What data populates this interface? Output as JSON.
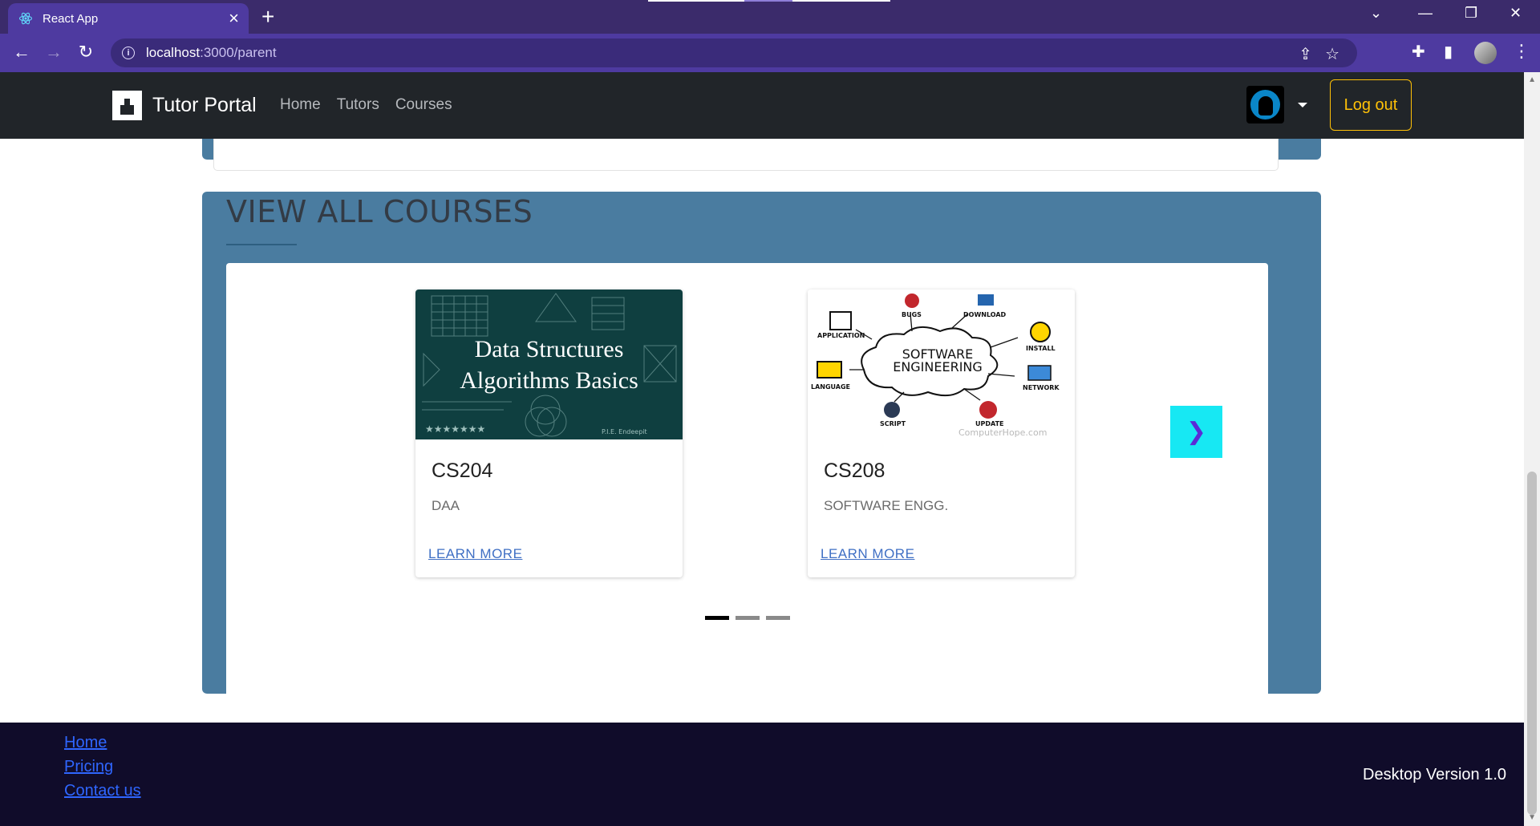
{
  "browser": {
    "tab_title": "React App",
    "url_host": "localhost",
    "url_path": ":3000/parent"
  },
  "navbar": {
    "brand": "Tutor Portal",
    "links": [
      "Home",
      "Tutors",
      "Courses"
    ],
    "logout_label": "Log out"
  },
  "courses": {
    "title": "VIEW ALL COURSES",
    "cards": [
      {
        "code": "CS204",
        "name": "DAA",
        "link_label": "LEARN MORE",
        "image_line1": "Data Structures",
        "image_line2": "Algorithms Basics"
      },
      {
        "code": "CS208",
        "name": "SOFTWARE ENGG.",
        "link_label": "LEARN MORE",
        "image_center": [
          "SOFTWARE",
          "ENGINEERING"
        ],
        "image_labels": [
          "APPLICATION",
          "BUGS",
          "DOWNLOAD",
          "INSTALL",
          "LANGUAGE",
          "NETWORK",
          "SCRIPT",
          "UPDATE"
        ],
        "image_watermark": "ComputerHope.com"
      }
    ],
    "next_icon": "chevron-right-icon",
    "slides_count": 3,
    "active_slide": 1
  },
  "footer": {
    "links": [
      "Home",
      "Pricing",
      "Contact us"
    ],
    "version": "Desktop Version 1.0"
  },
  "colors": {
    "browser_frame": "#4e3aa0",
    "navbar_bg": "#212529",
    "section_bg": "#4a7ca0",
    "logout_accent": "#ffc107",
    "next_button": "#17e8f3",
    "footer_bg": "#100c2a",
    "footer_link": "#2f66ff"
  }
}
